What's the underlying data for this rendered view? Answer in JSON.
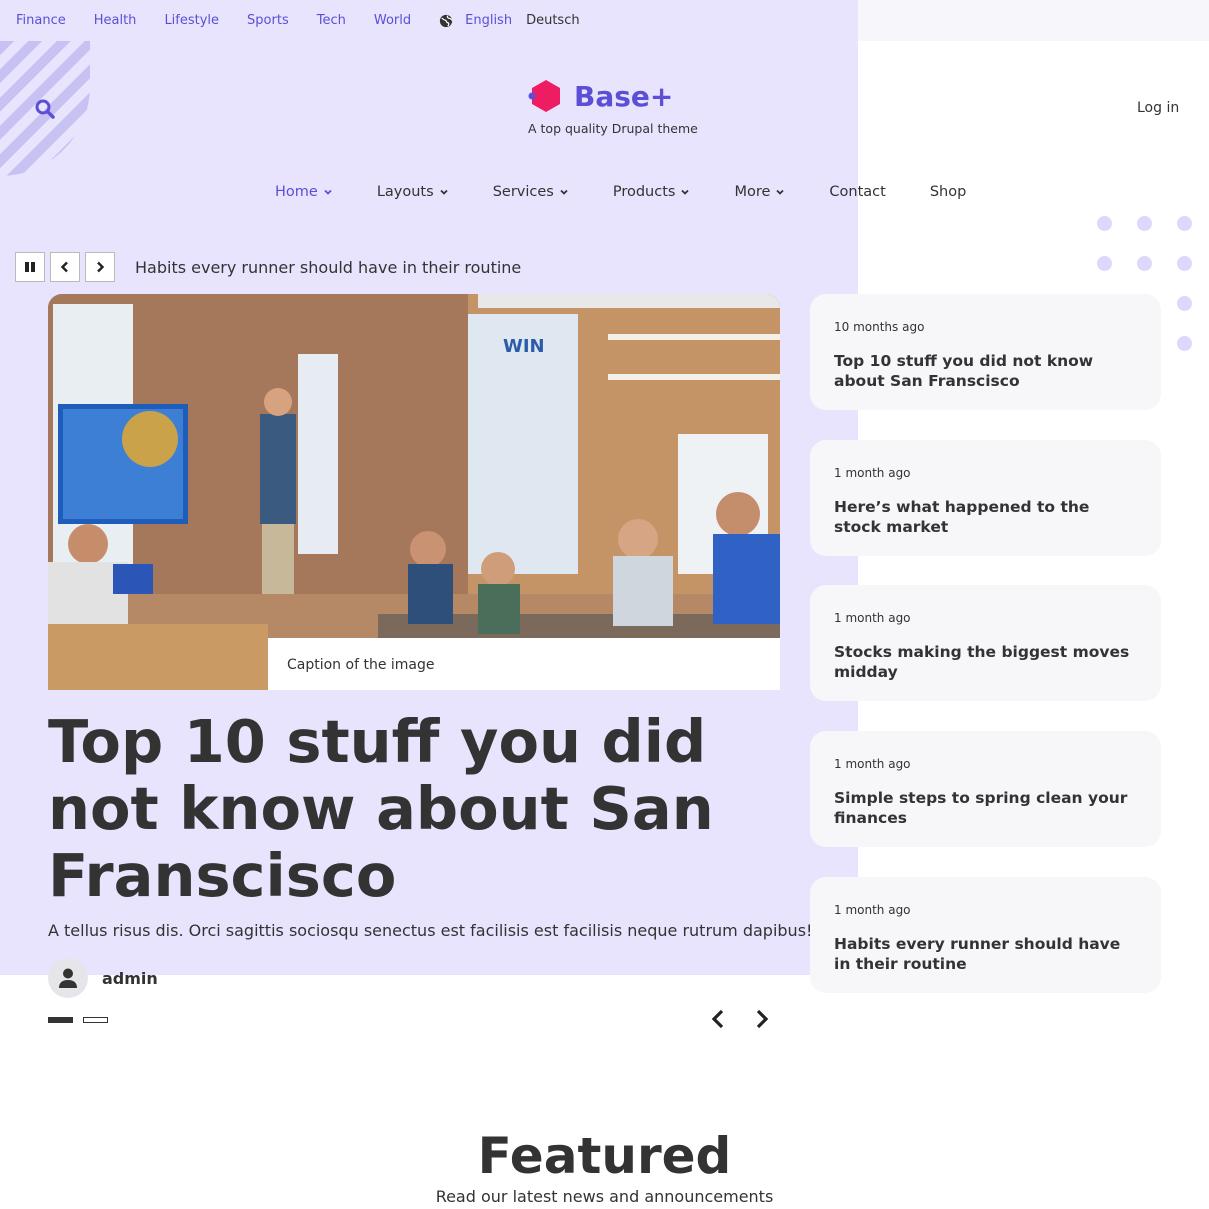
{
  "topbar": {
    "categories": [
      "Finance",
      "Health",
      "Lifestyle",
      "Sports",
      "Tech",
      "World"
    ],
    "languages": [
      "English",
      "Deutsch"
    ]
  },
  "brand": {
    "name": "Base+",
    "tagline": "A top quality Drupal theme"
  },
  "header": {
    "login_label": "Log in"
  },
  "nav": {
    "items": [
      {
        "label": "Home",
        "has_menu": true
      },
      {
        "label": "Layouts",
        "has_menu": true
      },
      {
        "label": "Services",
        "has_menu": true
      },
      {
        "label": "Products",
        "has_menu": true
      },
      {
        "label": "More",
        "has_menu": true
      },
      {
        "label": "Contact",
        "has_menu": false
      },
      {
        "label": "Shop",
        "has_menu": false
      }
    ]
  },
  "ticker": {
    "text": "Habits every runner should have in their routine"
  },
  "hero": {
    "caption": "Caption of the image",
    "title": "Top 10 stuff you did not know about San Franscisco",
    "summary": "A tellus risus dis. Orci sagittis sociosqu senectus est facilisis est facilisis neque rutrum dapibus!",
    "author": "admin",
    "slide_count": 2,
    "active_slide": 1
  },
  "latest": [
    {
      "time": "10 months ago",
      "title": "Top 10 stuff you did not know about San Franscisco"
    },
    {
      "time": "1 month ago",
      "title": "Here’s what happened to the stock market"
    },
    {
      "time": "1 month ago",
      "title": "Stocks making the biggest moves midday"
    },
    {
      "time": "1 month ago",
      "title": "Simple steps to spring clean your finances"
    },
    {
      "time": "1 month ago",
      "title": "Habits every runner should have in their routine"
    }
  ],
  "featured": {
    "title": "Featured",
    "subtitle": "Read our latest news and announcements"
  },
  "colors": {
    "accent": "#5b4fd6",
    "lavender_bg": "#e8e4fd",
    "card_bg": "#f7f7fa",
    "logo_pink": "#ee1d63"
  }
}
